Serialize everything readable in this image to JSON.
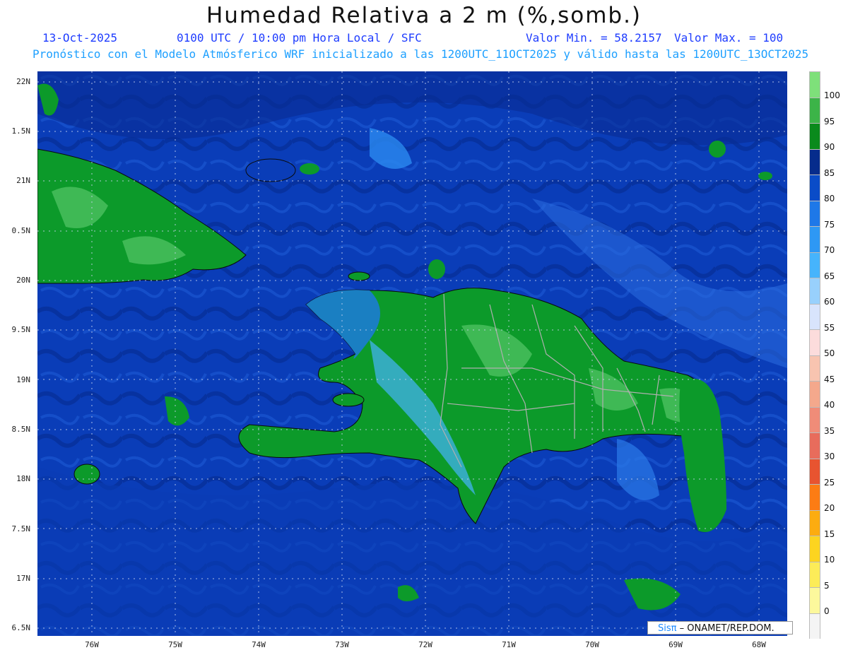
{
  "title": "Humedad Relativa a 2 m (%,somb.)",
  "header": {
    "date": "13-Oct-2025",
    "time": "0100 UTC / 10:00 pm Hora Local / SFC",
    "min": "Valor Min. = 58.2157",
    "max": "Valor Max. = 100",
    "model_info": "Pronóstico con el Modelo Atmósferico WRF inicializado a las 1200UTC_11OCT2025 y válido hasta las  1200UTC_13OCT2025"
  },
  "map": {
    "lat_labels": [
      "22N",
      "1.5N",
      "21N",
      "0.5N",
      "20N",
      "9.5N",
      "19N",
      "8.5N",
      "18N",
      "7.5N",
      "17N",
      "6.5N"
    ],
    "lon_labels": [
      "76W",
      "75W",
      "74W",
      "73W",
      "72W",
      "71W",
      "70W",
      "69W",
      "68W"
    ],
    "ocean_color": "#0a3db8",
    "deep_color": "#082b93",
    "land_green": "#0c9a2a"
  },
  "colorbar": {
    "labels": [
      "100",
      "95",
      "90",
      "85",
      "80",
      "75",
      "70",
      "65",
      "60",
      "55",
      "50",
      "45",
      "40",
      "35",
      "30",
      "25",
      "20",
      "15",
      "10",
      "5",
      "0"
    ],
    "colors": [
      "#7ee07a",
      "#3cb448",
      "#0a8a1c",
      "#062c8c",
      "#0a4cc8",
      "#1e78e8",
      "#2e98f4",
      "#46b4fc",
      "#98d0fc",
      "#d8e4fc",
      "#fcdcdc",
      "#f8c4b0",
      "#f4a88c",
      "#f08c78",
      "#e86c5c",
      "#e85430",
      "#fc7c14",
      "#fcac10",
      "#fcd420",
      "#fcec58",
      "#fcf89c",
      "#f4f4f4"
    ]
  },
  "credit": {
    "brand": "Sisπ",
    "text": "– ONAMET/REP.DOM."
  }
}
